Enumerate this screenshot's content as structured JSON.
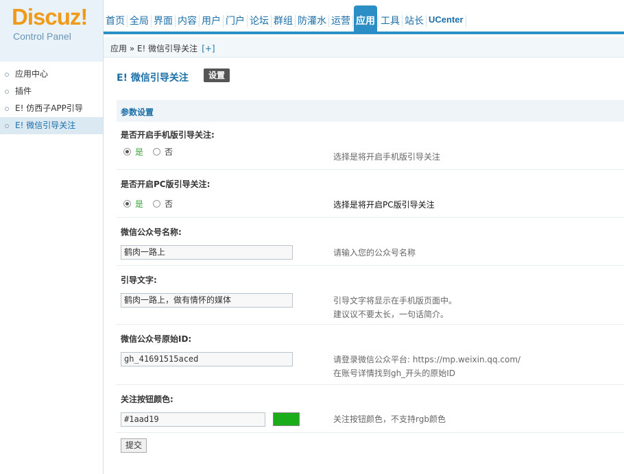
{
  "brand": {
    "title": "Discuz!",
    "subtitle": "Control Panel"
  },
  "topnav": [
    {
      "label": "首页",
      "active": false
    },
    {
      "label": "全局",
      "active": false
    },
    {
      "label": "界面",
      "active": false
    },
    {
      "label": "内容",
      "active": false
    },
    {
      "label": "用户",
      "active": false
    },
    {
      "label": "门户",
      "active": false
    },
    {
      "label": "论坛",
      "active": false
    },
    {
      "label": "群组",
      "active": false
    },
    {
      "label": "防灌水",
      "active": false
    },
    {
      "label": "运营",
      "active": false
    },
    {
      "label": "应用",
      "active": true
    },
    {
      "label": "工具",
      "active": false
    },
    {
      "label": "站长",
      "active": false
    },
    {
      "label": "UCenter",
      "active": false
    }
  ],
  "breadcrumb": {
    "text": "应用 » E! 微信引导关注",
    "plus": "[+]"
  },
  "sidebar": {
    "items": [
      {
        "label": "应用中心"
      },
      {
        "label": "插件"
      },
      {
        "label": "E! 仿西子APP引导"
      },
      {
        "label": "E! 微信引导关注"
      }
    ]
  },
  "main": {
    "title": "E! 微信引导关注",
    "tab": "设置",
    "section": "参数设置",
    "fields": {
      "mobile_guide": {
        "label": "是否开启手机版引导关注:",
        "yes": "是",
        "no": "否",
        "selected": "是",
        "tip": "选择是将开启手机版引导关注"
      },
      "pc_guide": {
        "label": "是否开启PC版引导关注:",
        "yes": "是",
        "no": "否",
        "selected": "是",
        "tip": "选择是将开启PC版引导关注"
      },
      "account_name": {
        "label": "微信公众号名称:",
        "value": "鹤肉一路上",
        "tip": "请输入您的公众号名称"
      },
      "guide_text": {
        "label": "引导文字:",
        "value": "鹤肉一路上，做有情怀的媒体",
        "tip1": "引导文字将显示在手机版页面中。",
        "tip2": "建议议不要太长，一句话简介。"
      },
      "origin_id": {
        "label": "微信公众号原始ID:",
        "value": "gh_41691515aced",
        "tip1": "请登录微信公众平台: https://mp.weixin.qq.com/",
        "tip2": "在账号详情找到gh_开头的原始ID"
      },
      "button_color": {
        "label": "关注按钮颜色:",
        "value": "#1aad19",
        "swatch": "#1aad19",
        "tip": "关注按钮颜色，不支持rgb颜色"
      }
    },
    "submit": "提交"
  }
}
